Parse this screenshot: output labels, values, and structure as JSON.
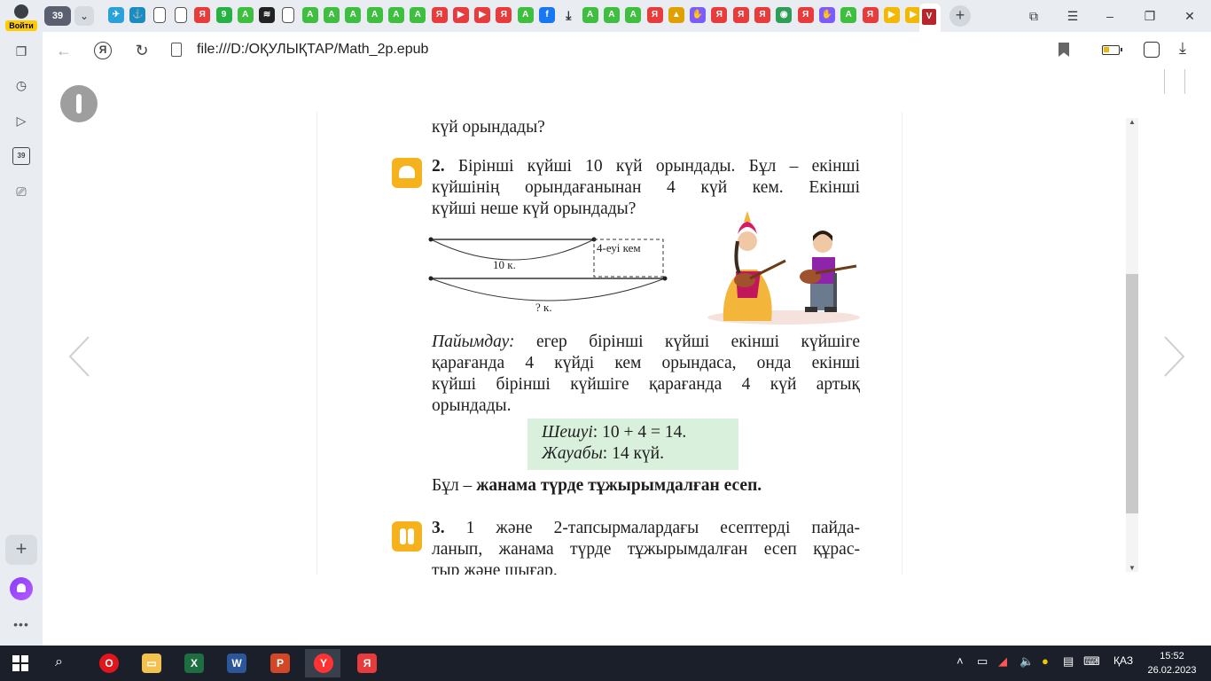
{
  "browser": {
    "login_label": "Войти",
    "tab_count": "39",
    "tab_chevron": "⌄",
    "tab_icons": [
      {
        "name": "telegram-icon",
        "color": "#2aa1da",
        "glyph": "✈"
      },
      {
        "name": "bird-icon",
        "color": "#1a8cbf",
        "glyph": "⚓"
      },
      {
        "name": "doc-icon",
        "color": "#ffffff",
        "glyph": ""
      },
      {
        "name": "doc-icon",
        "color": "#ffffff",
        "glyph": ""
      },
      {
        "name": "yandex-icon",
        "color": "#e83b3b",
        "glyph": "Я"
      },
      {
        "name": "whatsapp-icon",
        "color": "#27b043",
        "glyph": "9"
      },
      {
        "name": "game-icon",
        "color": "#3fbf3f",
        "glyph": "A"
      },
      {
        "name": "csv-icon",
        "color": "#222222",
        "glyph": "≋"
      },
      {
        "name": "doc-icon",
        "color": "#ffffff",
        "glyph": ""
      },
      {
        "name": "game-icon",
        "color": "#3fbf3f",
        "glyph": "A"
      },
      {
        "name": "game-icon",
        "color": "#3fbf3f",
        "glyph": "A"
      },
      {
        "name": "game-icon",
        "color": "#3fbf3f",
        "glyph": "A"
      },
      {
        "name": "game-icon",
        "color": "#3fbf3f",
        "glyph": "A"
      },
      {
        "name": "game-icon",
        "color": "#3fbf3f",
        "glyph": "A"
      },
      {
        "name": "game-icon",
        "color": "#3fbf3f",
        "glyph": "A"
      },
      {
        "name": "yandex-icon",
        "color": "#e83b3b",
        "glyph": "Я"
      },
      {
        "name": "video-icon",
        "color": "#e83b3b",
        "glyph": "▶"
      },
      {
        "name": "video-icon",
        "color": "#e83b3b",
        "glyph": "▶"
      },
      {
        "name": "yandex-icon",
        "color": "#e83b3b",
        "glyph": "Я"
      },
      {
        "name": "game-icon",
        "color": "#3fbf3f",
        "glyph": "A"
      },
      {
        "name": "facebook-icon",
        "color": "#1877f2",
        "glyph": "f"
      },
      {
        "name": "download-icon",
        "color": "#333333",
        "glyph": "⤓"
      },
      {
        "name": "game-icon",
        "color": "#3fbf3f",
        "glyph": "A"
      },
      {
        "name": "game-icon",
        "color": "#3fbf3f",
        "glyph": "A"
      },
      {
        "name": "game-icon",
        "color": "#3fbf3f",
        "glyph": "A"
      },
      {
        "name": "yandex-icon",
        "color": "#e83b3b",
        "glyph": "Я"
      },
      {
        "name": "image-icon",
        "color": "#e0a100",
        "glyph": "▲"
      },
      {
        "name": "hand-icon",
        "color": "#7a5cff",
        "glyph": "✋"
      },
      {
        "name": "yandex-icon",
        "color": "#e83b3b",
        "glyph": "Я"
      },
      {
        "name": "yandex-icon",
        "color": "#e83b3b",
        "glyph": "Я"
      },
      {
        "name": "yandex-icon",
        "color": "#e83b3b",
        "glyph": "Я"
      },
      {
        "name": "globe-icon",
        "color": "#2e9d57",
        "glyph": "◉"
      },
      {
        "name": "yandex-icon",
        "color": "#e83b3b",
        "glyph": "Я"
      },
      {
        "name": "hand-icon",
        "color": "#7a5cff",
        "glyph": "✋"
      },
      {
        "name": "game-icon",
        "color": "#3fbf3f",
        "glyph": "A"
      },
      {
        "name": "yandex-icon",
        "color": "#e83b3b",
        "glyph": "Я"
      },
      {
        "name": "play-icon",
        "color": "#f5b800",
        "glyph": "▶"
      },
      {
        "name": "play-icon",
        "color": "#f5b800",
        "glyph": "▶"
      }
    ],
    "active_tab_glyph": "V",
    "new_tab_glyph": "+",
    "url": "file:///D:/ОҚУЛЫҚТАР/Math_2p.epub",
    "yandex_glyph": "Я"
  },
  "book": {
    "top_line": "күй орындады?",
    "task2_num": "2.",
    "task2_lines": [
      "Бірінші күйші 10 күй орындады. Бұл – екінші",
      "күйшінің орындағанынан 4 күй кем. Екінші",
      "күйші неше күй орындады?"
    ],
    "diagram": {
      "label_top": "10 к.",
      "label_diff": "4-еуі кем",
      "label_bottom": "? к."
    },
    "reasoning_title": "Пайымдау:",
    "reasoning_lines": [
      "егер бірінші күйші екінші күйшіге",
      "қарағанда 4 күйді кем орындаса, онда екінші",
      "күйші бірінші күйшіге қарағанда 4 күй артық",
      "орындады."
    ],
    "solution_label": "Шешуі",
    "solution_expr": ": 10 + 4 = 14.",
    "answer_label": "Жауабы",
    "answer_expr": ": 14 күй.",
    "summary_prefix": "Бұл – ",
    "summary_bold": "жанама түрде тұжырымдалған есеп.",
    "task3_num": "3.",
    "task3_lines": [
      "1 және 2-тапсырмалардағы есептерді пайда-",
      "ланып, жанама түрде тұжырымдалған есеп құрас-",
      "тыр және шығар."
    ]
  },
  "sidebar": {
    "counter_badge": "39",
    "plus_label": "+",
    "more_label": "•••"
  },
  "taskbar": {
    "apps": [
      {
        "name": "opera-icon",
        "color": "#e0161c",
        "glyph": "O"
      },
      {
        "name": "file-explorer-icon",
        "color": "#f2c14e",
        "glyph": "▭"
      },
      {
        "name": "excel-icon",
        "color": "#1d6f42",
        "glyph": "X"
      },
      {
        "name": "word-icon",
        "color": "#2b579a",
        "glyph": "W"
      },
      {
        "name": "powerpoint-icon",
        "color": "#d24726",
        "glyph": "P"
      },
      {
        "name": "yandex-browser-icon",
        "color": "#ff3333",
        "glyph": "Y"
      },
      {
        "name": "yandex-icon",
        "color": "#e83b3b",
        "glyph": "Я"
      }
    ],
    "language": "ҚАЗ",
    "time": "15:52",
    "date": "26.02.2023"
  }
}
